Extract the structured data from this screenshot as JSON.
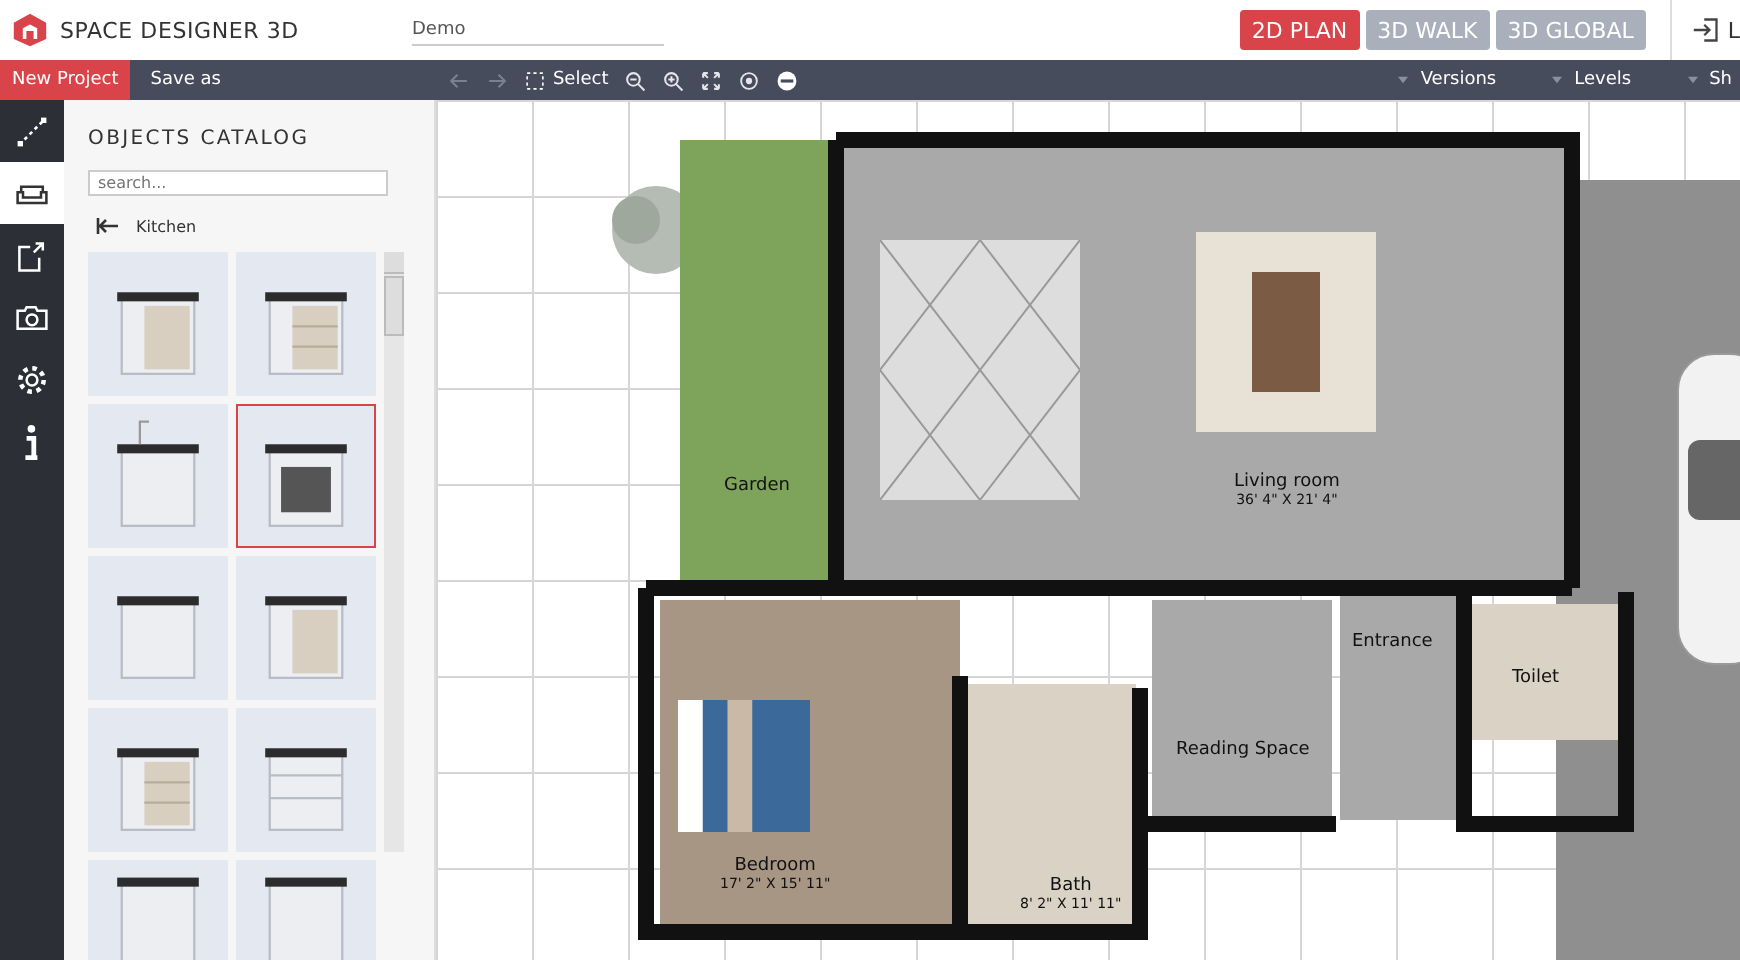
{
  "header": {
    "app_name": "SPACE DESIGNER 3D",
    "project_name": "Demo",
    "view_tabs": [
      {
        "label": "2D PLAN",
        "selected": true
      },
      {
        "label": "3D WALK",
        "selected": false
      },
      {
        "label": "3D GLOBAL",
        "selected": false
      }
    ],
    "login_label": "L"
  },
  "toolbar": {
    "new_project": "New Project",
    "save_as": "Save as",
    "select": "Select",
    "menus": [
      "Versions",
      "Levels",
      "Sh"
    ]
  },
  "rail": [
    {
      "kind": "resize",
      "selected": false
    },
    {
      "kind": "sofa",
      "selected": true
    },
    {
      "kind": "export",
      "selected": false
    },
    {
      "kind": "camera",
      "selected": false
    },
    {
      "kind": "gear",
      "selected": false
    },
    {
      "kind": "info",
      "selected": false
    }
  ],
  "catalog": {
    "title": "OBJECTS CATALOG",
    "search": {
      "placeholder": "search..."
    },
    "breadcrumb": "Kitchen",
    "items": [
      {
        "kind": "cabinet",
        "selected": false
      },
      {
        "kind": "drawers",
        "selected": false
      },
      {
        "kind": "sink",
        "selected": false
      },
      {
        "kind": "oven",
        "selected": true
      },
      {
        "kind": "narrow",
        "selected": false
      },
      {
        "kind": "cabinet",
        "selected": false
      },
      {
        "kind": "drawers",
        "selected": false
      },
      {
        "kind": "shelf",
        "selected": false
      },
      {
        "kind": "tall",
        "selected": false
      },
      {
        "kind": "tall",
        "selected": false
      }
    ]
  },
  "plan": {
    "rooms": [
      {
        "name": "Garden",
        "kind": "grass"
      },
      {
        "name": "Living room",
        "dims": "36' 4\" X 21' 4\"",
        "kind": "tile"
      },
      {
        "name": "Entrance",
        "kind": "tile"
      },
      {
        "name": "Toilet",
        "kind": "beige"
      },
      {
        "name": "Reading Space",
        "kind": "tile"
      },
      {
        "name": "Bedroom",
        "dims": "17' 2\" X 15' 11\"",
        "kind": "wood"
      },
      {
        "name": "Bath",
        "dims": "8' 2\" X 11' 11\"",
        "kind": "beige"
      }
    ]
  }
}
